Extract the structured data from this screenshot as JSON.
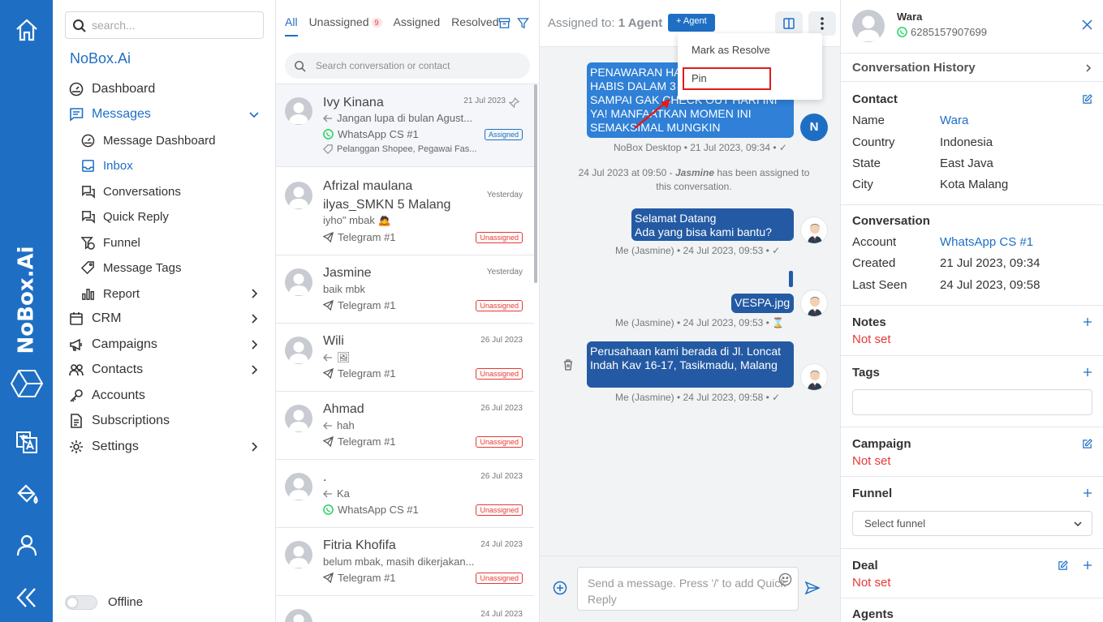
{
  "app": {
    "brand": "NoBox.Ai",
    "accent": "#1e6fc4"
  },
  "sidebar": {
    "search_placeholder": "search...",
    "brand_name": "NoBox.Ai",
    "items": [
      {
        "label": "Dashboard"
      },
      {
        "label": "Messages"
      },
      {
        "label": "Message Dashboard"
      },
      {
        "label": "Inbox"
      },
      {
        "label": "Conversations"
      },
      {
        "label": "Quick Reply"
      },
      {
        "label": "Funnel"
      },
      {
        "label": "Message Tags"
      },
      {
        "label": "Report"
      },
      {
        "label": "CRM"
      },
      {
        "label": "Campaigns"
      },
      {
        "label": "Contacts"
      },
      {
        "label": "Accounts"
      },
      {
        "label": "Subscriptions"
      },
      {
        "label": "Settings"
      }
    ],
    "status_label": "Offline"
  },
  "list": {
    "tabs": [
      {
        "label": "All"
      },
      {
        "label": "Unassigned",
        "count": "9"
      },
      {
        "label": "Assigned"
      },
      {
        "label": "Resolved"
      }
    ],
    "search_placeholder": "Search conversation or contact",
    "conversations": [
      {
        "name": "Ivy Kinana",
        "date": "21 Jul 2023",
        "preview": "Jangan lupa di bulan Agust...",
        "channel": "WhatsApp CS #1",
        "badge": "Assigned",
        "tags": "Pelanggan Shopee, Pegawai Fas..."
      },
      {
        "name": "Afrizal maulana ilyas_SMKN 5 Malang",
        "date": "Yesterday",
        "preview": "iyho\" mbak 🙇",
        "channel": "Telegram #1",
        "badge": "Unassigned"
      },
      {
        "name": "Jasmine",
        "date": "Yesterday",
        "preview": "baik mbk",
        "channel": "Telegram #1",
        "badge": "Unassigned"
      },
      {
        "name": "Wili",
        "date": "26 Jul 2023",
        "preview": "🖼",
        "channel": "Telegram #1",
        "badge": "Unassigned"
      },
      {
        "name": "Ahmad",
        "date": "26 Jul 2023",
        "preview": "hah",
        "channel": "Telegram #1",
        "badge": "Unassigned"
      },
      {
        "name": ".",
        "date": "26 Jul 2023",
        "preview": "Ka",
        "channel": "WhatsApp CS #1",
        "badge": "Unassigned"
      },
      {
        "name": "Fitria Khofifa",
        "date": "24 Jul 2023",
        "preview": "belum mbak, masih dikerjakan...",
        "channel": "Telegram #1",
        "badge": "Unassigned"
      },
      {
        "name": "",
        "date": "24 Jul 2023",
        "preview": "",
        "channel": "",
        "badge": ""
      }
    ]
  },
  "chat": {
    "assigned_label": "Assigned to:",
    "assigned_value": "1 Agent",
    "add_agent_label": "+ Agent",
    "messages": [
      {
        "text": "PENAWARAN HARGA SPESIAL AKAN HABIS DALAM 3 HARI LAGI! JANGAN SAMPAI GAK CHECK OUT HARI INI YA! MANFAATKAN MOMEN INI SEMAKSIMAL MUNGKIN",
        "meta": "NoBox Desktop • 21 Jul 2023, 09:34 • ✓",
        "avatar": "N"
      },
      {
        "text": "Selamat Datang\nAda yang bisa kami bantu?",
        "meta": "Me (Jasmine) • 24 Jul 2023, 09:53 • ✓"
      },
      {
        "text": "VESPA.jpg",
        "meta": "Me (Jasmine) • 24 Jul 2023, 09:53 • ⌛"
      },
      {
        "text": "Perusahaan kami berada di Jl. Loncat Indah Kav 16-17, Tasikmadu, Malang",
        "meta": "Me (Jasmine) • 24 Jul 2023, 09:58 • ✓"
      }
    ],
    "system_prefix": "24 Jul 2023 at 09:50 - ",
    "system_name": "Jasmine",
    "system_suffix": " has been assigned to this conversation.",
    "compose_placeholder": "Send a message. Press '/' to add Quick Reply",
    "menu": [
      {
        "label": "Mark as Resolve"
      },
      {
        "label": "Pin"
      }
    ]
  },
  "details": {
    "contact_name": "Wara",
    "contact_phone": "6285157907699",
    "history_title": "Conversation History",
    "contact_title": "Contact",
    "contact_fields": [
      {
        "label": "Name",
        "value": "Wara"
      },
      {
        "label": "Country",
        "value": "Indonesia"
      },
      {
        "label": "State",
        "value": "East Java"
      },
      {
        "label": "City",
        "value": "Kota Malang"
      }
    ],
    "conversation_title": "Conversation",
    "conversation_fields": [
      {
        "label": "Account",
        "value": "WhatsApp CS #1"
      },
      {
        "label": "Created",
        "value": "21 Jul 2023, 09:34"
      },
      {
        "label": "Last Seen",
        "value": "24 Jul 2023, 09:58"
      }
    ],
    "notes_title": "Notes",
    "notes_value": "Not set",
    "tags_title": "Tags",
    "campaign_title": "Campaign",
    "campaign_value": "Not set",
    "funnel_title": "Funnel",
    "funnel_placeholder": "Select funnel",
    "deal_title": "Deal",
    "deal_value": "Not set",
    "agents_title": "Agents"
  }
}
